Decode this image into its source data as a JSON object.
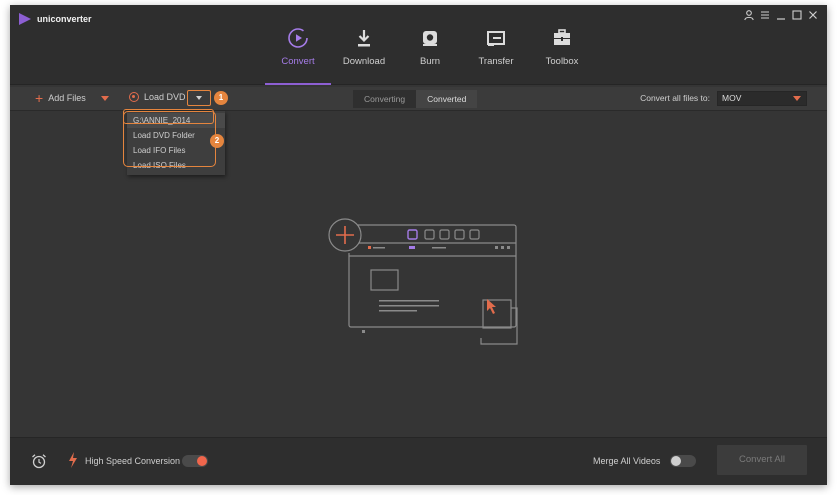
{
  "app": {
    "name": "uniconverter"
  },
  "nav": {
    "items": [
      {
        "label": "Convert",
        "icon": "convert-icon"
      },
      {
        "label": "Download",
        "icon": "download-icon"
      },
      {
        "label": "Burn",
        "icon": "burn-icon"
      },
      {
        "label": "Transfer",
        "icon": "transfer-icon"
      },
      {
        "label": "Toolbox",
        "icon": "toolbox-icon"
      }
    ],
    "active": "Convert"
  },
  "toolbar": {
    "add_files": "Add Files",
    "load_dvd": "Load DVD",
    "tabs": {
      "converting": "Converting",
      "converted": "Converted"
    },
    "convert_all_label": "Convert all files to:",
    "format_value": "MOV"
  },
  "badges": {
    "one": "1",
    "two": "2"
  },
  "dvd_menu": {
    "items": [
      "G:\\ANNIE_2014",
      "Load DVD Folder",
      "Load IFO Files",
      "Load ISO Files"
    ]
  },
  "bottom": {
    "high_speed": "High Speed Conversion",
    "high_speed_on": true,
    "merge": "Merge All Videos",
    "merge_on": false,
    "convert_all": "Convert All"
  },
  "colors": {
    "accent": "#8d5fd3",
    "orange": "#e26c4c",
    "highlight": "#e5853e"
  }
}
